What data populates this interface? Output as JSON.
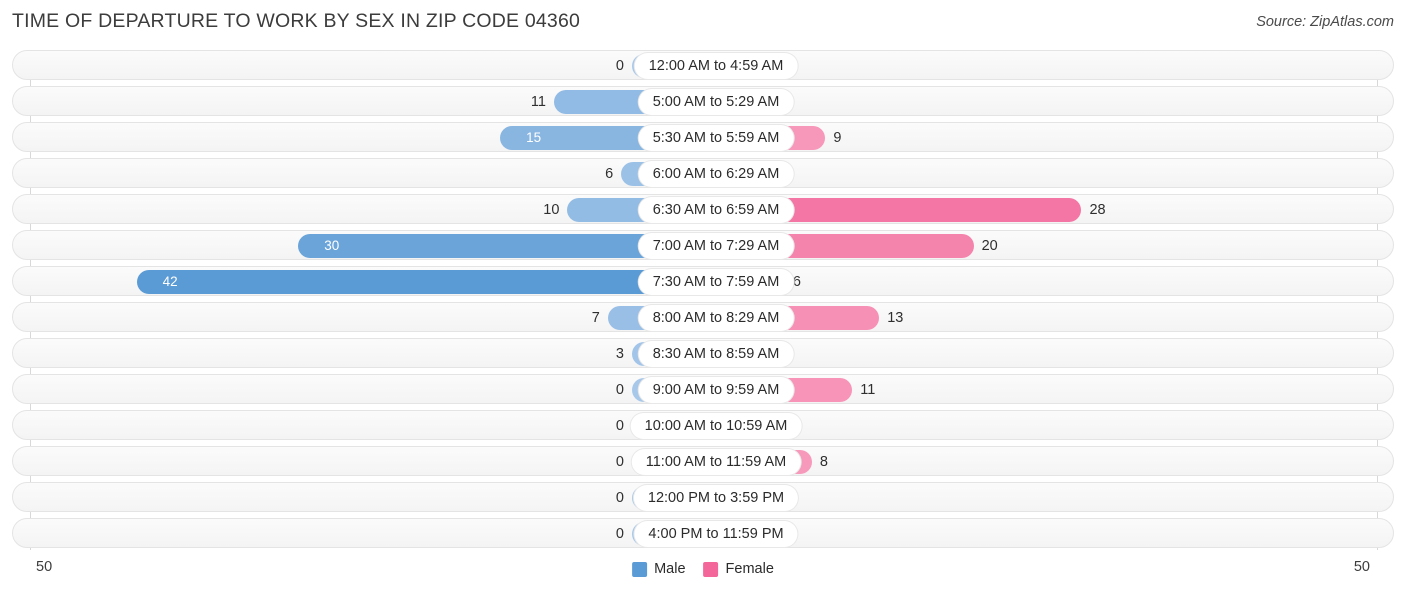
{
  "header": {
    "title": "TIME OF DEPARTURE TO WORK BY SEX IN ZIP CODE 04360",
    "source": "Source: ZipAtlas.com"
  },
  "axis": {
    "left_label": "50",
    "right_label": "50",
    "max": 50
  },
  "legend": {
    "items": [
      {
        "label": "Male",
        "color": "#5b9bd5"
      },
      {
        "label": "Female",
        "color": "#f2669a"
      }
    ]
  },
  "chart_data": {
    "type": "bar",
    "title": "TIME OF DEPARTURE TO WORK BY SEX IN ZIP CODE 04360",
    "subtitle": "",
    "xlabel": "",
    "ylabel": "",
    "orientation": "horizontal-diverging",
    "grid": false,
    "legend_position": "bottom-center",
    "xlim": [
      50,
      0,
      50
    ],
    "axis_tick_labels": [
      "50",
      "50"
    ],
    "categories": [
      "12:00 AM to 4:59 AM",
      "5:00 AM to 5:29 AM",
      "5:30 AM to 5:59 AM",
      "6:00 AM to 6:29 AM",
      "6:30 AM to 6:59 AM",
      "7:00 AM to 7:29 AM",
      "7:30 AM to 7:59 AM",
      "8:00 AM to 8:29 AM",
      "8:30 AM to 8:59 AM",
      "9:00 AM to 9:59 AM",
      "10:00 AM to 10:59 AM",
      "11:00 AM to 11:59 AM",
      "12:00 PM to 3:59 PM",
      "4:00 PM to 11:59 PM"
    ],
    "series": [
      {
        "name": "Male",
        "color": "#5b9bd5",
        "values": [
          0,
          11,
          15,
          6,
          10,
          30,
          42,
          7,
          3,
          0,
          0,
          0,
          0,
          0
        ]
      },
      {
        "name": "Female",
        "color": "#f2669a",
        "values": [
          2,
          0,
          9,
          0,
          28,
          20,
          6,
          13,
          0,
          11,
          0,
          8,
          0,
          2
        ]
      }
    ]
  }
}
